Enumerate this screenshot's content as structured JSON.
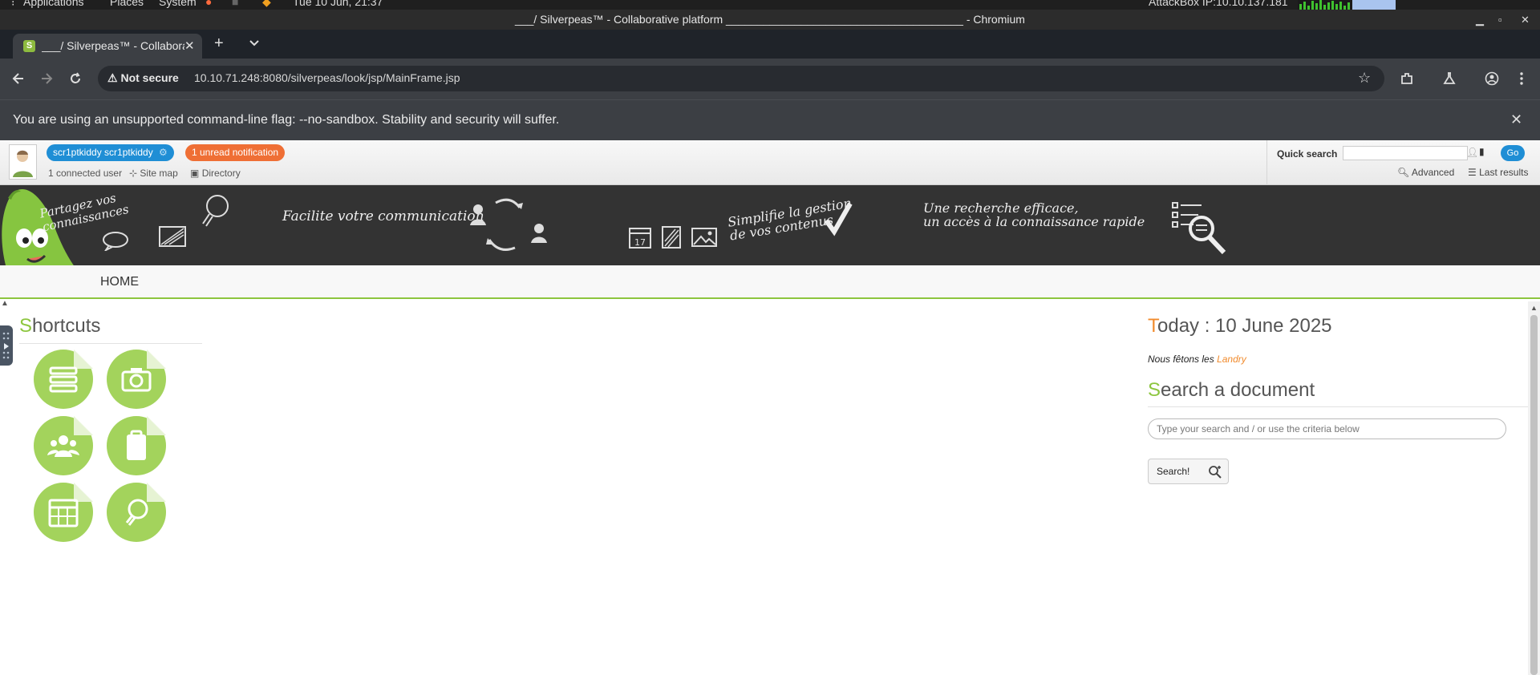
{
  "os_bar": {
    "applications": "Applications",
    "places": "Places",
    "system": "System",
    "clock": "Tue 10 Jun, 21:37",
    "machine": "AttackBox IP:10.10.137.181"
  },
  "window": {
    "title": "___/ Silverpeas™ - Collaborative platform ______________________________________ - Chromium"
  },
  "browser": {
    "tab_title": "___/ Silverpeas™ - Collaborative platform",
    "favicon_letter": "S",
    "security_label": "Not secure",
    "url": "10.10.71.248:8080/silverpeas/look/jsp/MainFrame.jsp",
    "warning": "You are using an unsupported command-line flag: --no-sandbox. Stability and security will suffer."
  },
  "topbar": {
    "user_name": "scr1ptkiddy scr1ptkiddy",
    "notifications": "1 unread notification",
    "connected_users": "1 connected user",
    "site_map": "Site map",
    "directory": "Directory",
    "quick_search_label": "Quick search",
    "quick_search_value": "",
    "go": "Go",
    "advanced": "Advanced",
    "last_results": "Last results"
  },
  "banner": {
    "slogan1": "Partagez vos connaissances",
    "slogan2": "Facilite votre communication",
    "slogan3_line1": "Simplifie la gestion",
    "slogan3_line2": "de vos contenus",
    "slogan4_line1": "Une recherche efficace,",
    "slogan4_line2": "un accès à la connaissance rapide",
    "calendar_day": "17"
  },
  "nav": {
    "home": "HOME"
  },
  "shortcuts": {
    "title_first": "S",
    "title_rest": "hortcuts",
    "items": [
      {
        "icon": "books-icon"
      },
      {
        "icon": "camera-icon"
      },
      {
        "icon": "people-icon"
      },
      {
        "icon": "clipboard-icon"
      },
      {
        "icon": "calendar-grid-icon"
      },
      {
        "icon": "lightbulb-icon"
      }
    ]
  },
  "today": {
    "title_first": "T",
    "title_rest": "oday : 10 June 2025",
    "feast_prefix": "Nous fêtons les",
    "saint": "Landry"
  },
  "search": {
    "title_first": "S",
    "title_rest": "earch a document",
    "placeholder": "Type your search and / or use the criteria below",
    "button": "Search!"
  },
  "colors": {
    "accent_green": "#8dc63f",
    "accent_blue": "#1f8ed5",
    "accent_orange": "#f18b2d",
    "banner_bg": "#333333"
  }
}
